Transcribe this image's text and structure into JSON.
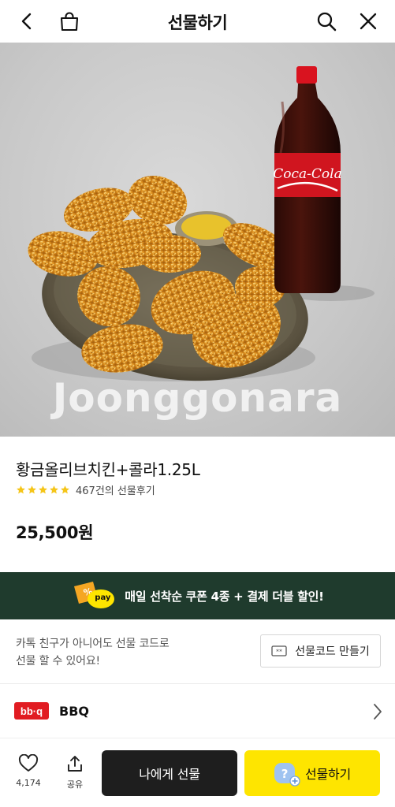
{
  "header": {
    "title": "선물하기"
  },
  "photo": {
    "watermark": "Joonggonara",
    "cola_label": "Coca-Cola"
  },
  "product": {
    "name": "황금올리브치킨+콜라1.25L",
    "rating_stars": 5,
    "review_text": "467건의 선물후기",
    "price": "25,500원",
    "star_color": "#f5c518"
  },
  "promo": {
    "text": "매일 선착순 쿠폰 4종 + 결제 더블 할인!",
    "badge_text": "pay",
    "bg_color": "#1f3b2d"
  },
  "gift_code": {
    "description_line1": "카톡 친구가 아니어도 선물 코드로",
    "description_line2": "선물 할 수 있어요!",
    "button_label": "선물코드 만들기"
  },
  "brand": {
    "logo_text": "bb·q",
    "name": "BBQ"
  },
  "bottom_bar": {
    "like_count": "4,174",
    "share_label": "공유",
    "self_button": "나에게 선물",
    "gift_button": "선물하기",
    "gift_color": "#fee500"
  }
}
